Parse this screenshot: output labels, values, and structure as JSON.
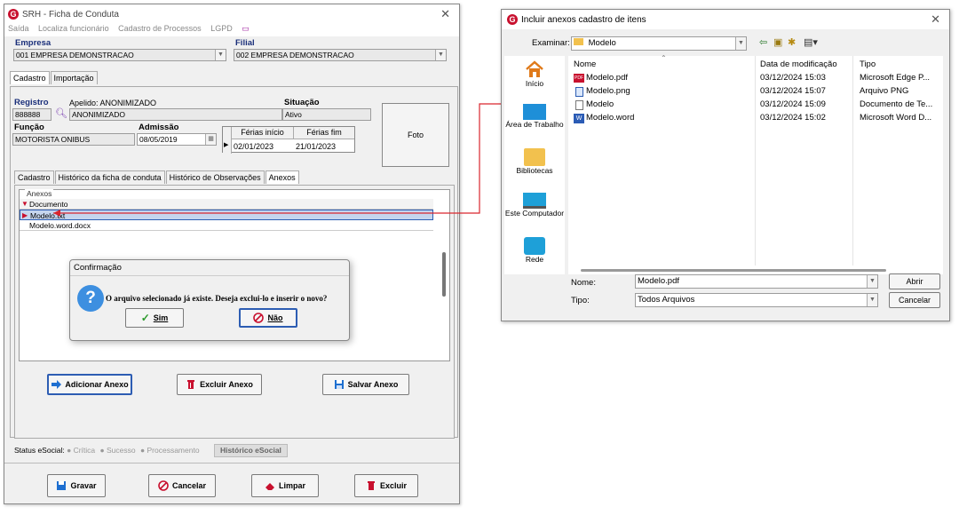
{
  "main_window": {
    "title": "SRH - Ficha de Conduta",
    "menu": [
      "Saída",
      "Localiza funcionário",
      "Cadastro de Processos",
      "LGPD"
    ],
    "empresa_label": "Empresa",
    "empresa_value": "001 EMPRESA DEMONSTRACAO",
    "filial_label": "Filial",
    "filial_value": "002 EMPRESA DEMONSTRACAO",
    "top_tabs": [
      "Cadastro",
      "Importação"
    ],
    "registro_label": "Registro",
    "registro_value": "888888",
    "apelido_label": "Apelido: ANONIMIZADO",
    "apelido_value": "ANONIMIZADO",
    "situacao_label": "Situação",
    "situacao_value": "Ativo",
    "funcao_label": "Função",
    "funcao_value": "MOTORISTA ONIBUS",
    "admissao_label": "Admissão",
    "admissao_value": "08/05/2019",
    "ferias_inicio_label": "Férias início",
    "ferias_fim_label": "Férias fim",
    "ferias_inicio_value": "02/01/2023",
    "ferias_fim_value": "21/01/2023",
    "foto_label": "Foto",
    "inner_tabs": [
      "Cadastro",
      "Histórico da ficha de conduta",
      "Histórico de Observações",
      "Anexos"
    ],
    "anexos_group": "Anexos",
    "anexos_header": "Documento",
    "anexos_rows": [
      "Modelo.txt",
      "Modelo.word.docx"
    ],
    "btn_adicionar": "Adicionar Anexo",
    "btn_excluir_anexo": "Excluir Anexo",
    "btn_salvar_anexo": "Salvar Anexo",
    "status_label": "Status eSocial:",
    "status_items": [
      "Crítica",
      "Sucesso",
      "Processamento"
    ],
    "historico_esocial": "Histórico eSocial",
    "btn_gravar": "Gravar",
    "btn_cancelar": "Cancelar",
    "btn_limpar": "Limpar",
    "btn_excluir": "Excluir"
  },
  "confirm_dialog": {
    "title": "Confirmação",
    "message": "O arquivo selecionado já existe. Deseja exclui-lo e inserir o novo?",
    "yes": "Sim",
    "no": "Não"
  },
  "file_dialog": {
    "title": "Incluir anexos cadastro de itens",
    "examinar_label": "Examinar:",
    "folder": "Modelo",
    "places": [
      "Início",
      "Área de Trabalho",
      "Bibliotecas",
      "Este Computador",
      "Rede"
    ],
    "columns": [
      "Nome",
      "Data de modificação",
      "Tipo"
    ],
    "files": [
      {
        "name": "Modelo.pdf",
        "date": "03/12/2024 15:03",
        "type": "Microsoft Edge P...",
        "icon": "pdf-icon"
      },
      {
        "name": "Modelo.png",
        "date": "03/12/2024 15:07",
        "type": "Arquivo PNG",
        "icon": "image-file-icon"
      },
      {
        "name": "Modelo",
        "date": "03/12/2024 15:09",
        "type": "Documento de Te...",
        "icon": "text-file-icon"
      },
      {
        "name": "Modelo.word",
        "date": "03/12/2024 15:02",
        "type": "Microsoft Word D...",
        "icon": "word-file-icon"
      }
    ],
    "nome_label": "Nome:",
    "nome_value": "Modelo.pdf",
    "tipo_label": "Tipo:",
    "tipo_value": "Todos Arquivos",
    "btn_abrir": "Abrir",
    "btn_cancelar": "Cancelar"
  },
  "colors": {
    "accent_red": "#c8102e",
    "selection": "#c5d5ee",
    "annotation": "#d9262e"
  }
}
